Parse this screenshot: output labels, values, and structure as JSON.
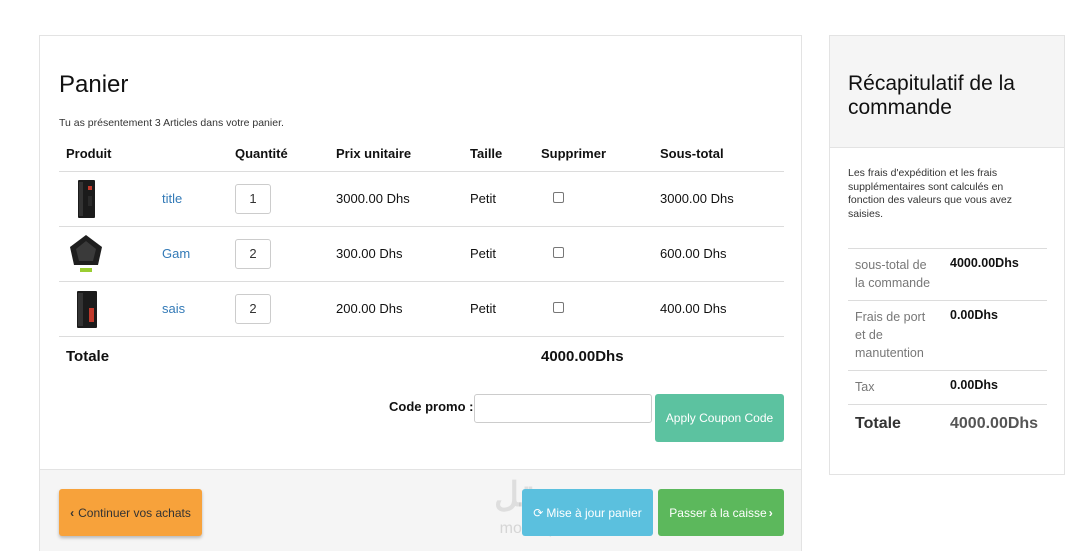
{
  "cart": {
    "title": "Panier",
    "subtitle": "Tu as présentement 3 Articles dans votre panier.",
    "headers": {
      "product": "Produit",
      "quantity": "Quantité",
      "unit_price": "Prix unitaire",
      "size": "Taille",
      "remove": "Supprimer",
      "subtotal": "Sous-total"
    },
    "items": [
      {
        "name": "title",
        "quantity": "1",
        "unit_price": "3000.00 Dhs",
        "size": "Petit",
        "subtotal": "3000.00 Dhs",
        "image": "pc-tower-image"
      },
      {
        "name": "Gam",
        "quantity": "2",
        "unit_price": "300.00 Dhs",
        "size": "Petit",
        "subtotal": "600.00 Dhs",
        "image": "gaming-pc-image"
      },
      {
        "name": "sais",
        "quantity": "2",
        "unit_price": "200.00 Dhs",
        "size": "Petit",
        "subtotal": "400.00 Dhs",
        "image": "pc-tower-image"
      }
    ],
    "total_label": "Totale",
    "total_value": "4000.00Dhs",
    "promo_label": "Code promo :",
    "promo_value": "",
    "apply_coupon": "Apply Coupon Code",
    "continue_shopping": "Continuer vos achats",
    "update_cart": "Mise à jour panier",
    "checkout": "Passer à la caisse",
    "watermark": "مستقل",
    "watermark_sub": "mostaql.com"
  },
  "summary": {
    "title": "Récapitulatif de la commande",
    "note": "Les frais d'expédition et les frais supplémentaires sont calculés en fonction des valeurs que vous avez saisies.",
    "rows": [
      {
        "label": "sous-total de la commande",
        "value": "4000.00Dhs"
      },
      {
        "label": "Frais de port et de manutention",
        "value": "0.00Dhs"
      },
      {
        "label": "Tax",
        "value": "0.00Dhs"
      }
    ],
    "total_label": "Totale",
    "total_value": "4000.00Dhs"
  },
  "colors": {
    "coupon": "#5cc2a0",
    "continue": "#f7a23b",
    "update": "#5bc0de",
    "checkout": "#5cb85c",
    "link": "#337ab7"
  }
}
